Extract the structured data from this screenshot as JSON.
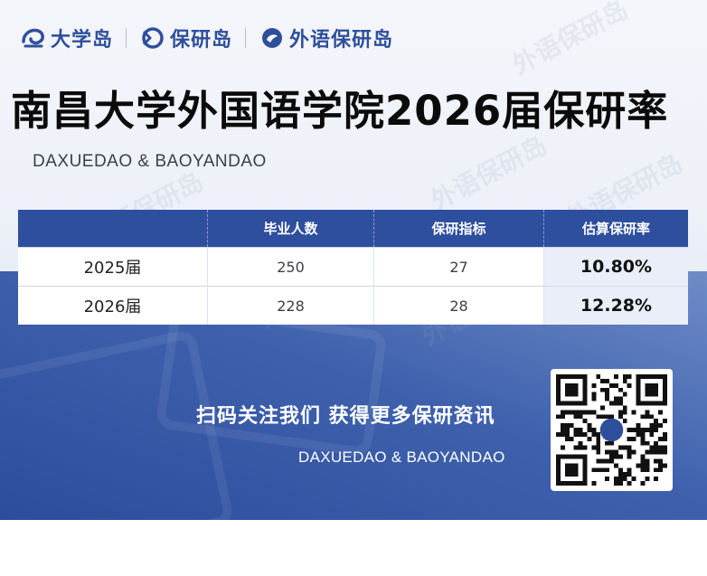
{
  "brand": {
    "logos": [
      {
        "text": "大学岛",
        "icon": "daxuedao-logo-icon"
      },
      {
        "text": "保研岛",
        "icon": "baoyandao-logo-icon"
      },
      {
        "text": "外语保研岛",
        "icon": "waiyu-baoyandao-logo-icon"
      }
    ],
    "watermark": "外语保研岛"
  },
  "page": {
    "title": "南昌大学外国语学院2026届保研率",
    "subtitle": "DAXUEDAO & BAOYANDAO"
  },
  "table": {
    "headers": [
      "",
      "毕业人数",
      "保研指标",
      "估算保研率"
    ],
    "rows": [
      {
        "year": "2025届",
        "graduates": "250",
        "quota": "27",
        "rate": "10.80%"
      },
      {
        "year": "2026届",
        "graduates": "228",
        "quota": "28",
        "rate": "12.28%"
      }
    ]
  },
  "footer": {
    "cta": "扫码关注我们 获得更多保研资讯",
    "tagline": "DAXUEDAO & BAOYANDAO",
    "qr_icon": "qr-code-icon"
  },
  "colors": {
    "primary": "#2e4e9e",
    "footer_gradient_start": "#6f8cc8",
    "footer_gradient_end": "#2b4d9c",
    "rate_cell_bg": "#e9eef9"
  }
}
